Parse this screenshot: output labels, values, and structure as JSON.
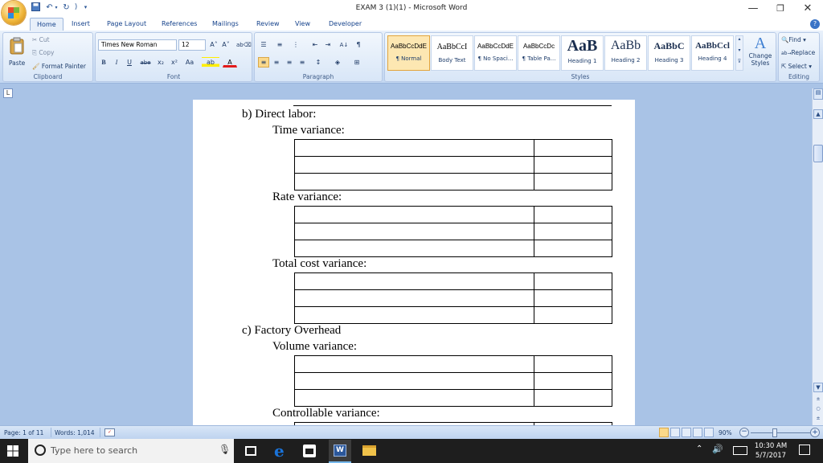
{
  "window": {
    "title": "EXAM 3 (1)(1) - Microsoft Word",
    "minimize": "—",
    "restore": "❐",
    "close": "✕"
  },
  "quick_access": [
    "save-icon",
    "undo-icon",
    "redo-icon",
    "customize-icon"
  ],
  "tabs": [
    "Home",
    "Insert",
    "Page Layout",
    "References",
    "Mailings",
    "Review",
    "View",
    "Developer"
  ],
  "ribbon": {
    "clipboard": {
      "label": "Clipboard",
      "paste": "Paste",
      "cut": "Cut",
      "copy": "Copy",
      "format_painter": "Format Painter"
    },
    "font": {
      "label": "Font",
      "font_name": "Times New Roman",
      "font_size": "12",
      "grow": "A˄",
      "shrink": "A˅",
      "bold": "B",
      "italic": "I",
      "underline": "U",
      "strike": "abe",
      "subscript": "x₂",
      "superscript": "x²",
      "case": "Aa"
    },
    "paragraph": {
      "label": "Paragraph"
    },
    "styles": {
      "label": "Styles",
      "items": [
        {
          "preview": "AaBbCcDdE",
          "name": "¶ Normal"
        },
        {
          "preview": "AaBbCcI",
          "name": "Body Text"
        },
        {
          "preview": "AaBbCcDdE",
          "name": "¶ No Spaci..."
        },
        {
          "preview": "AaBbCcDc",
          "name": "¶ Table Pa..."
        },
        {
          "preview": "AaB",
          "name": "Heading 1"
        },
        {
          "preview": "AaBb",
          "name": "Heading 2"
        },
        {
          "preview": "AaBbC",
          "name": "Heading 3"
        },
        {
          "preview": "AaBbCcl",
          "name": "Heading 4"
        }
      ],
      "change_styles": "Change Styles"
    },
    "editing": {
      "label": "Editing",
      "find": "Find",
      "replace": "Replace",
      "select": "Select"
    }
  },
  "document": {
    "sections": [
      {
        "text": "b) Direct labor:",
        "level": 1
      },
      {
        "text": "Time variance:",
        "level": 2
      },
      {
        "text": "Rate variance:",
        "level": 2
      },
      {
        "text": "Total cost variance:",
        "level": 2
      },
      {
        "text": "c) Factory Overhead",
        "level": 1
      },
      {
        "text": "Volume variance:",
        "level": 2
      },
      {
        "text": "Controllable variance:",
        "level": 2
      }
    ]
  },
  "status": {
    "page": "Page: 1 of 11",
    "words": "Words: 1,014",
    "zoom": "90%"
  },
  "taskbar": {
    "search_placeholder": "Type here to search",
    "time": "10:30 AM",
    "date": "5/7/2017"
  },
  "colors": {
    "ribbon_bg": "#dbe7f6",
    "workspace_bg": "#a9c3e6",
    "taskbar_bg": "#1e1e1e",
    "edge_blue": "#1a73d9"
  }
}
